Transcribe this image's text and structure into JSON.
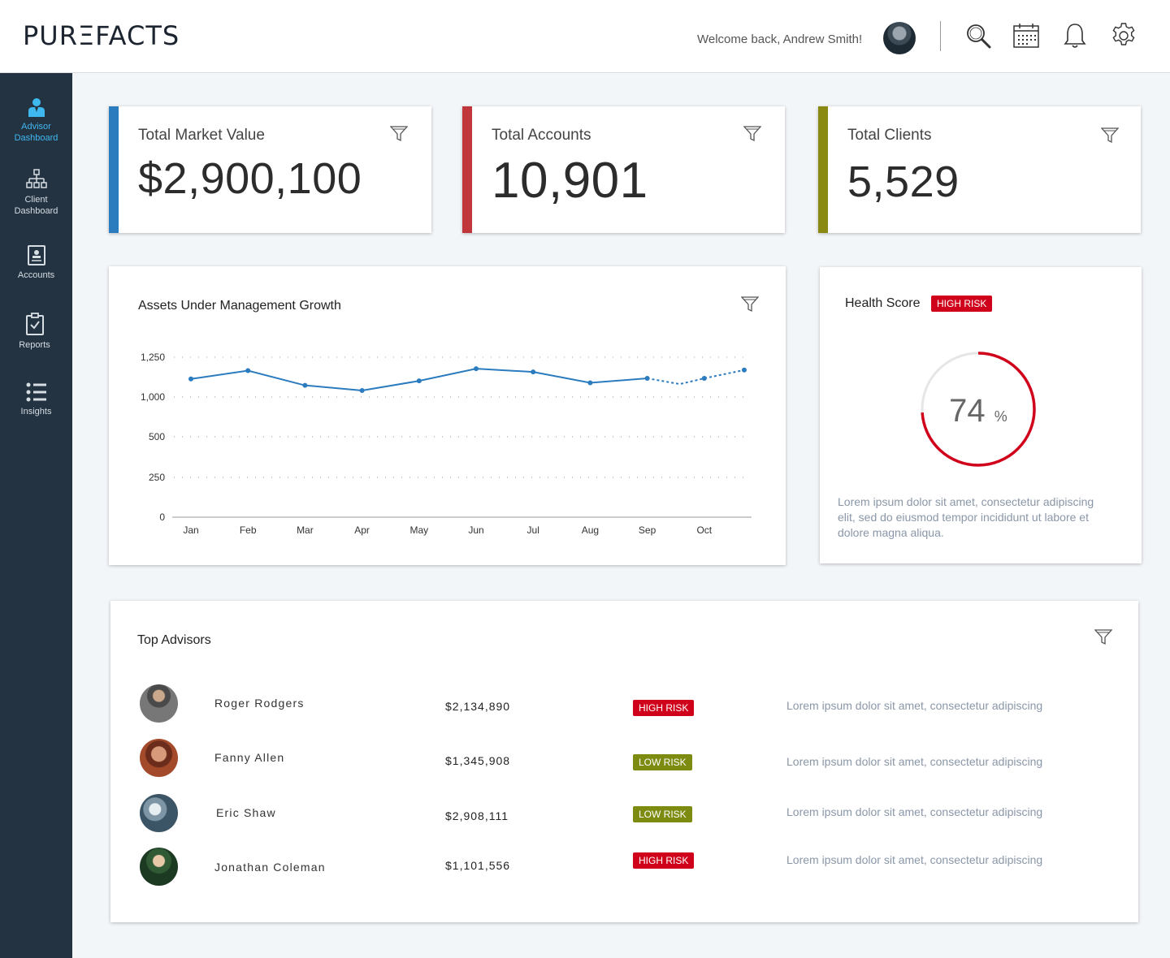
{
  "header": {
    "logo": "PURΞFACTS",
    "welcome": "Welcome back, Andrew Smith!",
    "icons": [
      "search-icon",
      "calendar-icon",
      "bell-icon",
      "settings-icon"
    ]
  },
  "sidebar": {
    "items": [
      {
        "label1": "Advisor",
        "label2": "Dashboard",
        "icon": "advisor-icon",
        "active": true
      },
      {
        "label1": "Client",
        "label2": "Dashboard",
        "icon": "hierarchy-icon",
        "active": false
      },
      {
        "label1": "Accounts",
        "label2": "",
        "icon": "accounts-icon",
        "active": false
      },
      {
        "label1": "Reports",
        "label2": "",
        "icon": "clipboard-check-icon",
        "active": false
      },
      {
        "label1": "Insights",
        "label2": "",
        "icon": "list-icon",
        "active": false
      }
    ],
    "active_color": "#3fb8f0"
  },
  "stats": [
    {
      "title": "Total Market Value",
      "value": "$2,900,100",
      "color": "#2b7bbf"
    },
    {
      "title": "Total Accounts",
      "value": "10,901",
      "color": "#c0363a"
    },
    {
      "title": "Total Clients",
      "value": "5,529",
      "color": "#8a8a12"
    }
  ],
  "aum_chart": {
    "title": "Assets Under Management Growth"
  },
  "chart_data": {
    "type": "line",
    "title": "Assets Under Management Growth",
    "categories": [
      "Jan",
      "Feb",
      "Mar",
      "Apr",
      "May",
      "Jun",
      "Jul",
      "Aug",
      "Sep",
      "Oct"
    ],
    "y_tick_labels": [
      "0",
      "250",
      "500",
      "1,000",
      "1,250"
    ],
    "y_ticks": [
      0,
      250,
      500,
      1000,
      1250
    ],
    "series": [
      {
        "values": [
          1080,
          1145,
          1030,
          990,
          1065,
          1160,
          1135,
          1050,
          1085,
          null,
          null
        ]
      },
      {
        "style": "dashed",
        "x_positions": [
          8,
          8.57,
          9,
          9.7
        ],
        "values": [
          1085,
          1040,
          1085,
          1150
        ]
      }
    ],
    "ylim": [
      0,
      1250
    ],
    "grid": true
  },
  "health": {
    "title": "Health Score",
    "badge": "HIGH RISK",
    "score": 74,
    "unit": "%",
    "desc": "Lorem ipsum dolor sit amet, consectetur adipiscing elit, sed do eiusmod tempor incididunt ut labore et dolore magna aliqua.",
    "ring_color": "#d0021b"
  },
  "advisors": {
    "title": "Top Advisors",
    "rows": [
      {
        "name": "Roger Rodgers",
        "value": "$2,134,890",
        "risk": "HIGH RISK",
        "risk_level": "high",
        "desc": "Lorem ipsum dolor sit amet, consectetur adipiscing"
      },
      {
        "name": "Fanny Allen",
        "value": "$1,345,908",
        "risk": "LOW RISK",
        "risk_level": "low",
        "desc": "Lorem ipsum dolor sit amet, consectetur adipiscing"
      },
      {
        "name": "Eric Shaw",
        "value": "$2,908,111",
        "risk": "LOW RISK",
        "risk_level": "low",
        "desc": "Lorem ipsum dolor sit amet, consectetur adipiscing"
      },
      {
        "name": "Jonathan Coleman",
        "value": "$1,101,556",
        "risk": "HIGH RISK",
        "risk_level": "high",
        "desc": "Lorem ipsum dolor sit amet, consectetur adipiscing"
      }
    ]
  }
}
